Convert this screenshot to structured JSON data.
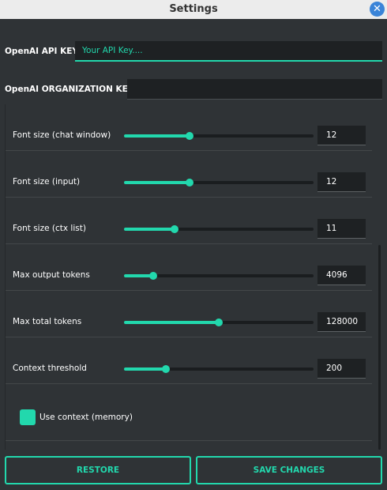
{
  "window": {
    "title": "Settings",
    "close_symbol": "✕"
  },
  "api_key": {
    "label": "OpenAI API KEY",
    "placeholder": "Your API Key....",
    "value": ""
  },
  "org_key": {
    "label": "OpenAI ORGANIZATION KEY",
    "placeholder": "",
    "value": ""
  },
  "settings": [
    {
      "label": "Font size (chat window)",
      "value": "12",
      "slider_fraction": 0.345
    },
    {
      "label": "Font size (input)",
      "value": "12",
      "slider_fraction": 0.345
    },
    {
      "label": "Font size (ctx list)",
      "value": "11",
      "slider_fraction": 0.267
    },
    {
      "label": "Max output tokens",
      "value": "4096",
      "slider_fraction": 0.154
    },
    {
      "label": "Max total tokens",
      "value": "128000",
      "slider_fraction": 0.5
    },
    {
      "label": "Context threshold",
      "value": "200",
      "slider_fraction": 0.221
    }
  ],
  "use_context": {
    "label": "Use context (memory)",
    "checked": true
  },
  "buttons": {
    "restore": "RESTORE",
    "save": "SAVE CHANGES"
  },
  "colors": {
    "accent": "#22d8ad",
    "background": "#2f3336",
    "input_bg": "#1e2123",
    "titlebar": "#ececec",
    "close": "#3a84d8"
  }
}
